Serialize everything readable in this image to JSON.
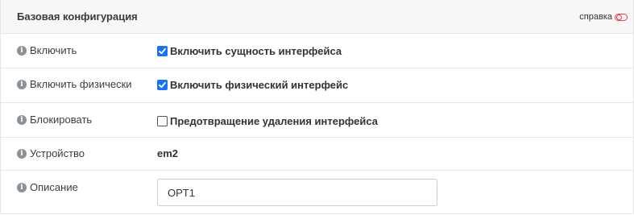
{
  "panel": {
    "title": "Базовая конфигурация",
    "help_label": "справка",
    "help_icon": "toggle-icon",
    "accent_color": "#e0434b"
  },
  "rows": [
    {
      "label": "Включить",
      "info_icon": "info-icon",
      "type": "checkbox",
      "checked": true,
      "value": "Включить сущность интерфейса"
    },
    {
      "label": "Включить физически",
      "info_icon": "info-icon",
      "type": "checkbox",
      "checked": true,
      "value": "Включить физический интерфейс"
    },
    {
      "label": "Блокировать",
      "info_icon": "info-icon",
      "type": "checkbox",
      "checked": false,
      "value": "Предотвращение удаления интерфейса"
    },
    {
      "label": "Устройство",
      "info_icon": "info-icon",
      "type": "text",
      "value": "em2"
    },
    {
      "label": "Описание",
      "info_icon": "info-icon",
      "type": "input",
      "value": "OPT1"
    }
  ],
  "colors": {
    "checkbox_checked": "#1a73e8",
    "header_bg": "#f7f7f7",
    "border": "#e6e6e6"
  }
}
